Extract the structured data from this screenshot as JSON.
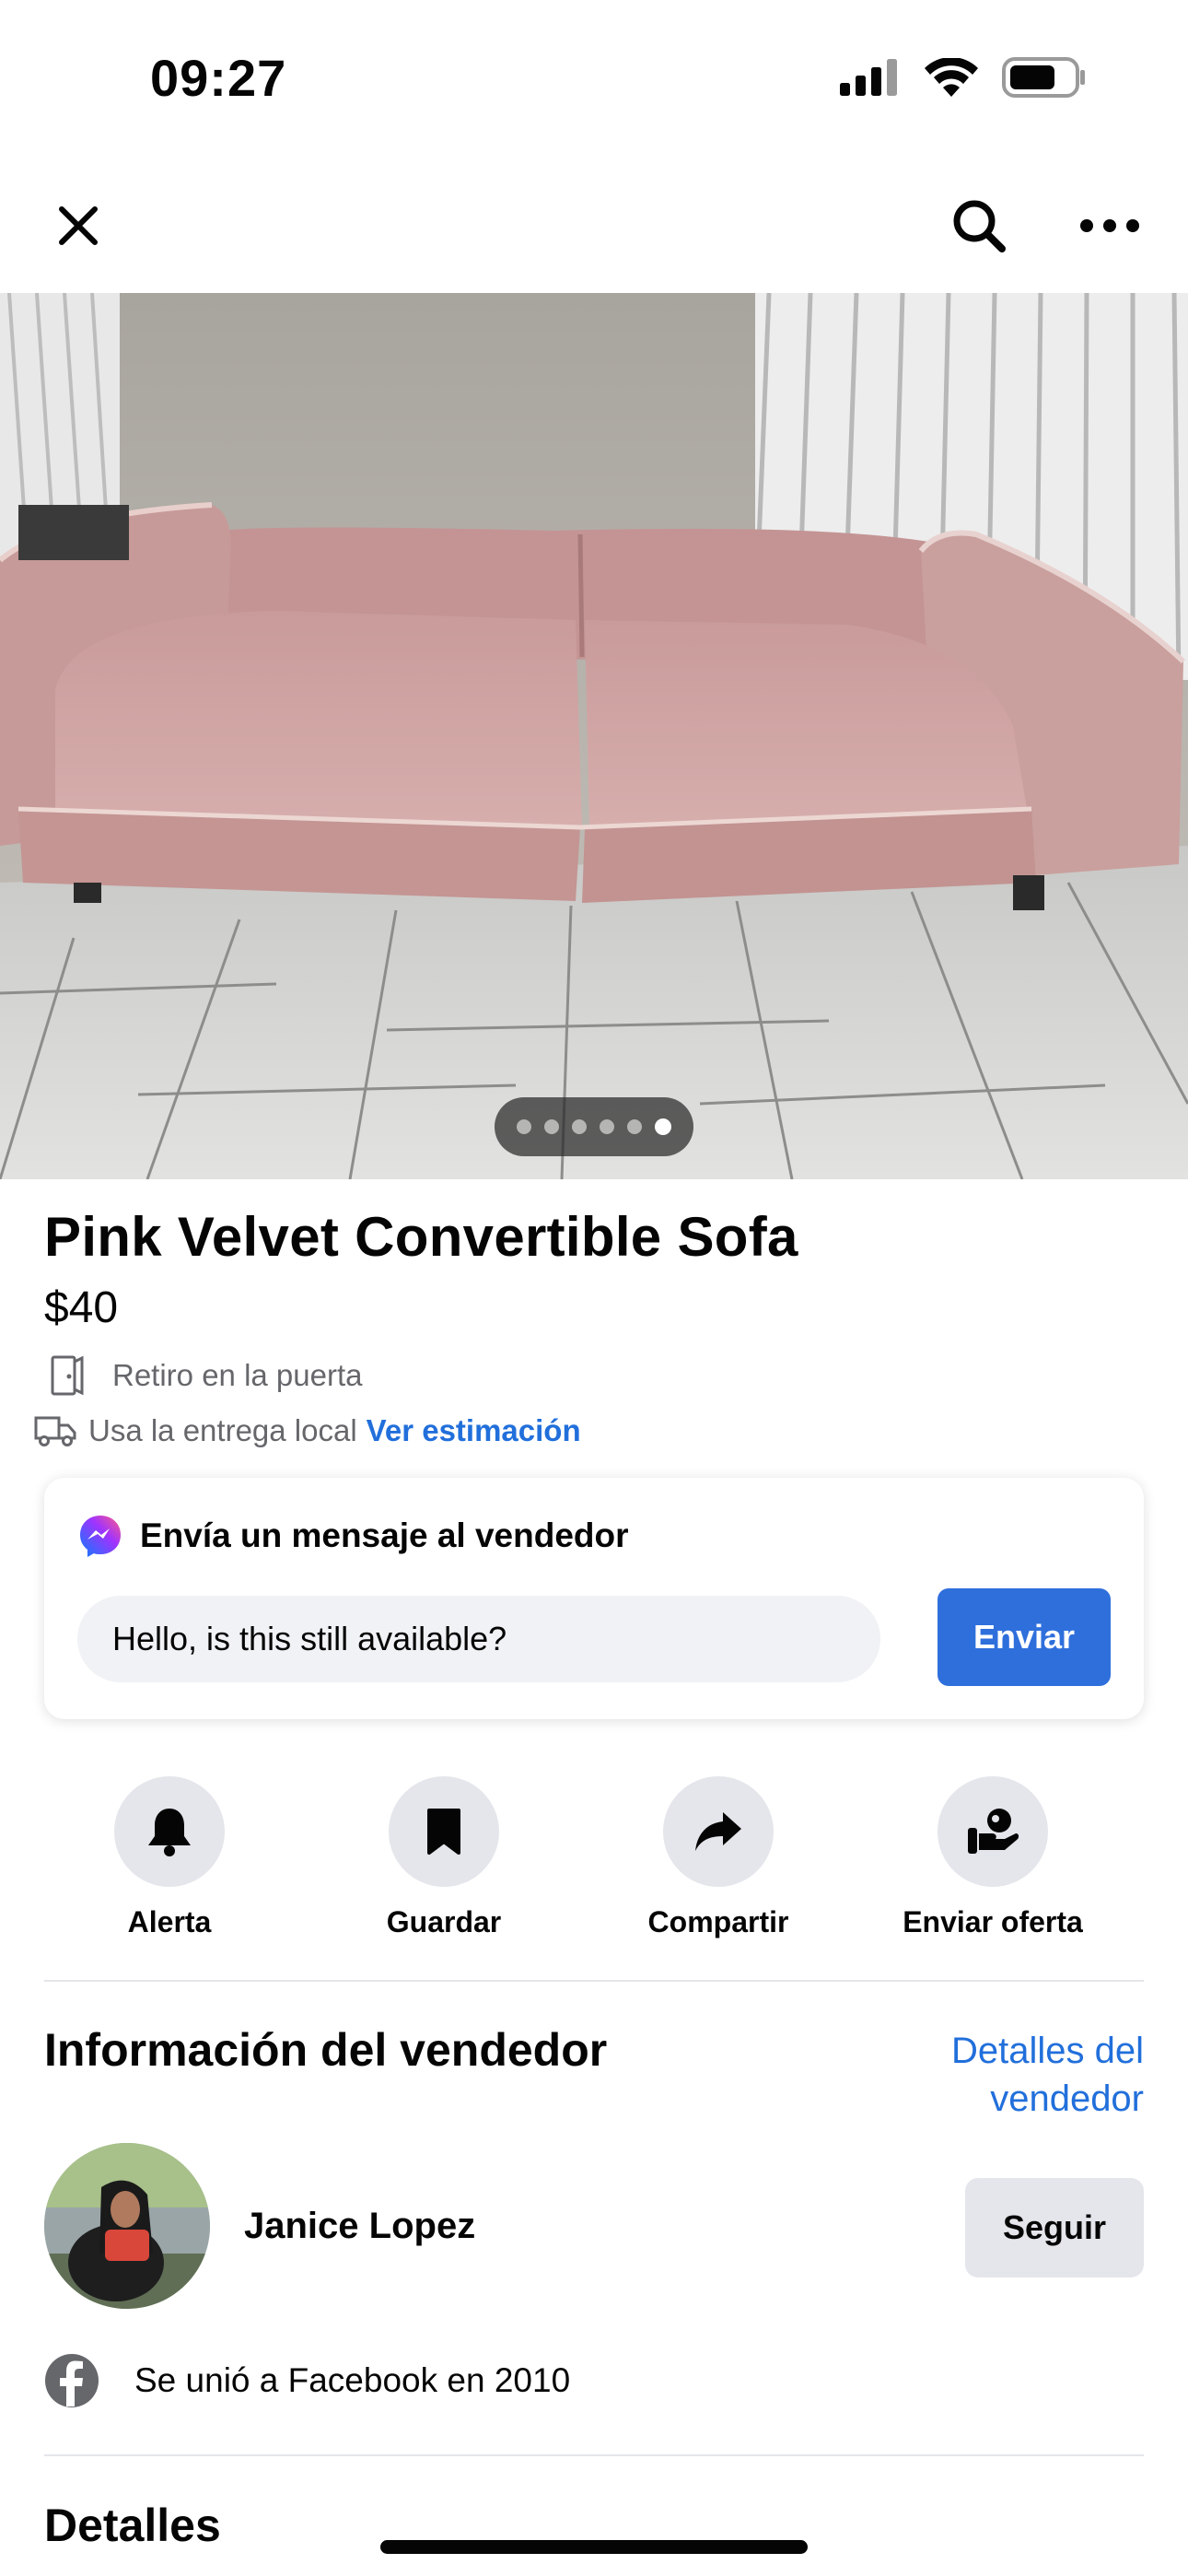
{
  "status": {
    "time": "09:27"
  },
  "listing": {
    "title": "Pink Velvet Convertible Sofa",
    "price": "$40",
    "pickup": "Retiro en la puerta",
    "delivery_text": "Usa la entrega local",
    "delivery_link": "Ver estimación",
    "photo_count": 6,
    "active_photo_index": 5
  },
  "message": {
    "heading": "Envía un mensaje al vendedor",
    "input_value": "Hello, is this still available?",
    "send_label": "Enviar"
  },
  "actions": [
    {
      "label": "Alerta",
      "icon": "bell-icon"
    },
    {
      "label": "Guardar",
      "icon": "bookmark-icon"
    },
    {
      "label": "Compartir",
      "icon": "share-icon"
    },
    {
      "label": "Enviar oferta",
      "icon": "offer-icon"
    }
  ],
  "seller": {
    "section_title": "Información del vendedor",
    "details_link_line1": "Detalles del",
    "details_link_line2": "vendedor",
    "name": "Janice Lopez",
    "follow_label": "Seguir",
    "joined": "Se unió a Facebook en 2010"
  },
  "details": {
    "section_title": "Detalles"
  },
  "colors": {
    "accent": "#216fdb",
    "button": "#2e6fdc",
    "chip": "#e4e6eb"
  }
}
